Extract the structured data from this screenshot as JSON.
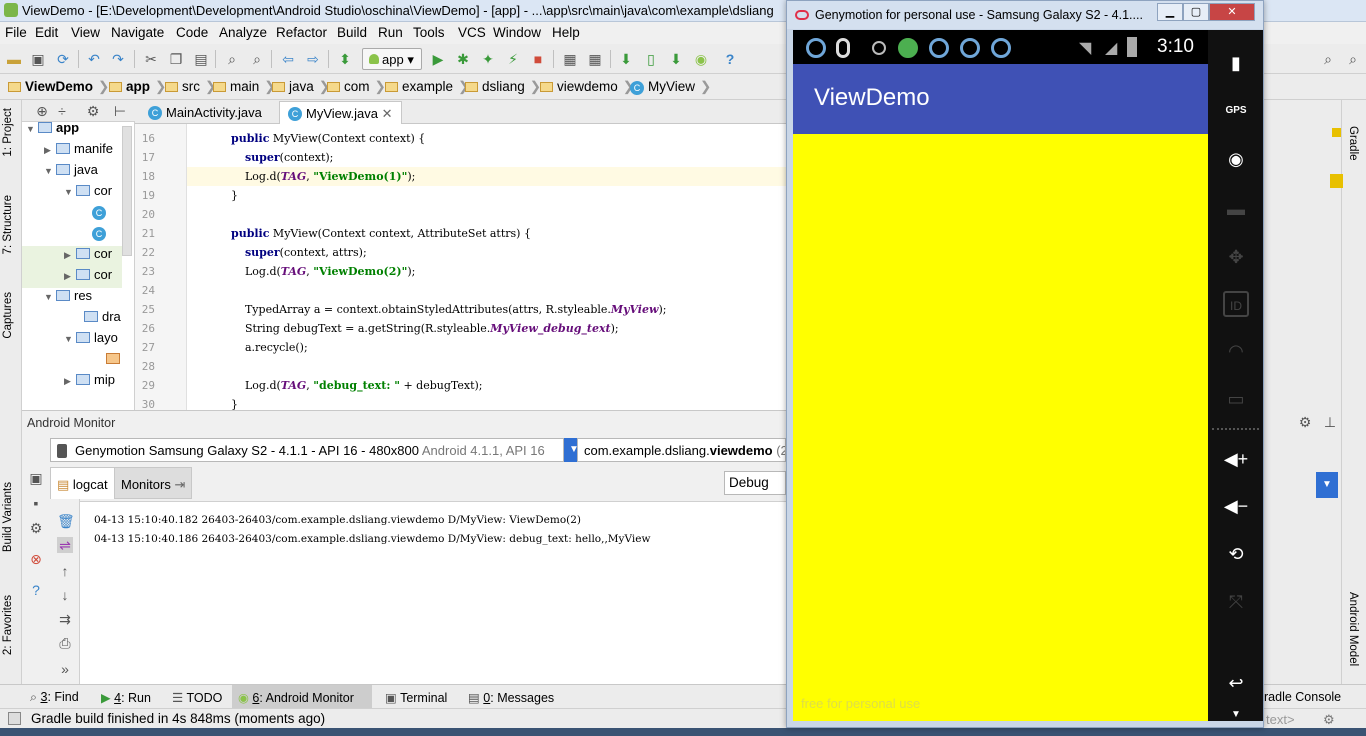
{
  "ide": {
    "window_title": "ViewDemo - [E:\\Development\\Development\\Android Studio\\oschina\\ViewDemo] - [app] - ...\\app\\src\\main\\java\\com\\example\\dsliang",
    "menu": [
      "File",
      "Edit",
      "View",
      "Navigate",
      "Code",
      "Analyze",
      "Refactor",
      "Build",
      "Run",
      "Tools",
      "VCS",
      "Window",
      "Help"
    ],
    "run_config": "app",
    "breadcrumbs": [
      "ViewDemo",
      "app",
      "src",
      "main",
      "java",
      "com",
      "example",
      "dsliang",
      "viewdemo",
      "MyView"
    ],
    "left_tabs": [
      "1: Project",
      "7: Structure",
      "Captures",
      "Build Variants",
      "2: Favorites"
    ],
    "project_tree": [
      {
        "label": "app",
        "level": 0,
        "type": "module"
      },
      {
        "label": "manife",
        "level": 1,
        "type": "folder"
      },
      {
        "label": "java",
        "level": 1,
        "type": "folder"
      },
      {
        "label": "cor",
        "level": 2,
        "type": "folder"
      },
      {
        "label": "",
        "level": 3,
        "type": "class"
      },
      {
        "label": "",
        "level": 3,
        "type": "class"
      },
      {
        "label": "cor",
        "level": 2,
        "type": "folder"
      },
      {
        "label": "cor",
        "level": 2,
        "type": "folder"
      },
      {
        "label": "res",
        "level": 1,
        "type": "folder"
      },
      {
        "label": "dra",
        "level": 2,
        "type": "folder"
      },
      {
        "label": "layo",
        "level": 2,
        "type": "folder"
      },
      {
        "label": "",
        "level": 3,
        "type": "file"
      },
      {
        "label": "mip",
        "level": 2,
        "type": "folder"
      }
    ],
    "editor_tabs": [
      {
        "label": "MainActivity.java",
        "active": false
      },
      {
        "label": "MyView.java",
        "active": true
      }
    ],
    "code_lines": [
      {
        "n": "16",
        "text": "    public MyView(Context context) {"
      },
      {
        "n": "17",
        "text": "        super(context);"
      },
      {
        "n": "18",
        "text": "        Log.d(TAG, \"ViewDemo(1)\");"
      },
      {
        "n": "19",
        "text": "    }"
      },
      {
        "n": "20",
        "text": ""
      },
      {
        "n": "21",
        "text": "    public MyView(Context context, AttributeSet attrs) {"
      },
      {
        "n": "22",
        "text": "        super(context, attrs);"
      },
      {
        "n": "23",
        "text": "        Log.d(TAG, \"ViewDemo(2)\");"
      },
      {
        "n": "24",
        "text": ""
      },
      {
        "n": "25",
        "text": "        TypedArray a = context.obtainStyledAttributes(attrs, R.styleable.MyView);"
      },
      {
        "n": "26",
        "text": "        String debugText = a.getString(R.styleable.MyView_debug_text);"
      },
      {
        "n": "27",
        "text": "        a.recycle();"
      },
      {
        "n": "28",
        "text": ""
      },
      {
        "n": "29",
        "text": "        Log.d(TAG, \"debug_text: \" + debugText);"
      },
      {
        "n": "30",
        "text": "    }"
      }
    ],
    "monitor": {
      "title": "Android Monitor",
      "device": "Genymotion Samsung Galaxy S2 - 4.1.1 - API 16 - 480x800",
      "device_detail": "Android 4.1.1, API 16",
      "process_prefix": "com.example.dsliang.",
      "process_name": "viewdemo",
      "process_suffix": " (2",
      "tabs": [
        "logcat",
        "Monitors"
      ],
      "log_level": "Debug",
      "logs": [
        "04-13 15:10:40.182 26403-26403/com.example.dsliang.viewdemo D/MyView: ViewDemo(2)",
        "04-13 15:10:40.186 26403-26403/com.example.dsliang.viewdemo D/MyView: debug_text: hello,,MyView"
      ]
    },
    "right_tabs": [
      "Gradle",
      "Android Model"
    ],
    "bottom_tabs": [
      {
        "num": "3",
        "label": ": Find"
      },
      {
        "num": "4",
        "label": ": Run"
      },
      {
        "num": "",
        "label": "TODO"
      },
      {
        "num": "6",
        "label": ": Android Monitor"
      },
      {
        "num": "",
        "label": "Terminal"
      },
      {
        "num": "0",
        "label": ": Messages"
      }
    ],
    "gradle_console": "radle Console",
    "status": "Gradle build finished in 4s 848ms (moments ago)",
    "status_right": "text>"
  },
  "genymotion": {
    "window_title": "Genymotion for personal use - Samsung Galaxy S2 - 4.1....",
    "clock": "3:10",
    "app_title": "ViewDemo",
    "watermark": "free for personal use",
    "colors": {
      "app_bar": "#3f51b5",
      "content": "#ffff00"
    }
  }
}
